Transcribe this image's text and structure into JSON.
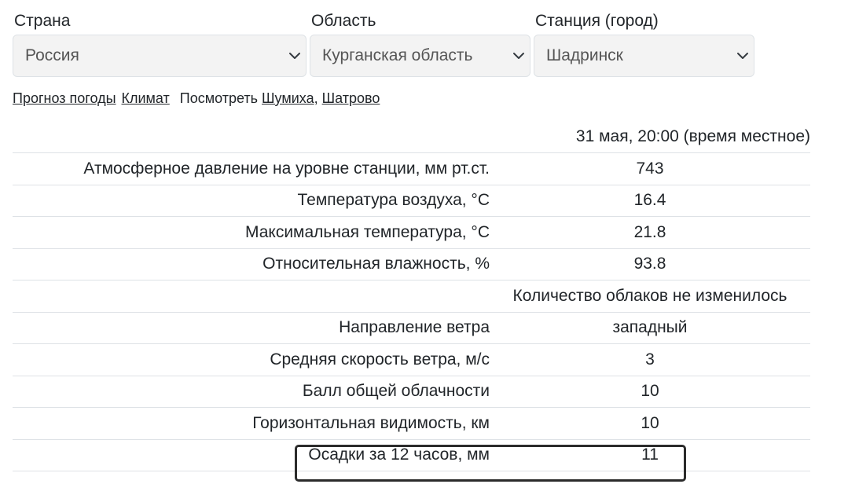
{
  "selectors": [
    {
      "label": "Страна",
      "value": "Россия"
    },
    {
      "label": "Область",
      "value": "Курганская область"
    },
    {
      "label": "Станция (город)",
      "value": "Шадринск"
    }
  ],
  "links": {
    "forecast": "Прогноз погоды",
    "climate": "Климат",
    "see_prefix": "Посмотреть",
    "nearby_1": "Шумиха",
    "separator": ",",
    "nearby_2": "Шатрово"
  },
  "table": {
    "header_time": "31 мая, 20:00 (время местное)",
    "rows": [
      {
        "label": "Атмосферное давление на уровне станции, мм рт.ст.",
        "value": "743"
      },
      {
        "label": "Температура воздуха, °C",
        "value": "16.4"
      },
      {
        "label": "Максимальная температура, °C",
        "value": "21.8"
      },
      {
        "label": "Относительная влажность, %",
        "value": "93.8"
      },
      {
        "label": "",
        "value": "Количество облаков не изменилось"
      },
      {
        "label": "Направление ветра",
        "value": "западный"
      },
      {
        "label": "Средняя скорость ветра, м/с",
        "value": "3"
      },
      {
        "label": "Балл общей облачности",
        "value": "10"
      },
      {
        "label": "Горизонтальная видимость, км",
        "value": "10"
      },
      {
        "label": "Осадки за 12 часов, мм",
        "value": "11"
      }
    ]
  },
  "icons": {
    "select_arrow": "chevron-down-icon"
  },
  "colors": {
    "highlight_border": "#2b2b2b",
    "select_bg": "#f3f3f3"
  }
}
